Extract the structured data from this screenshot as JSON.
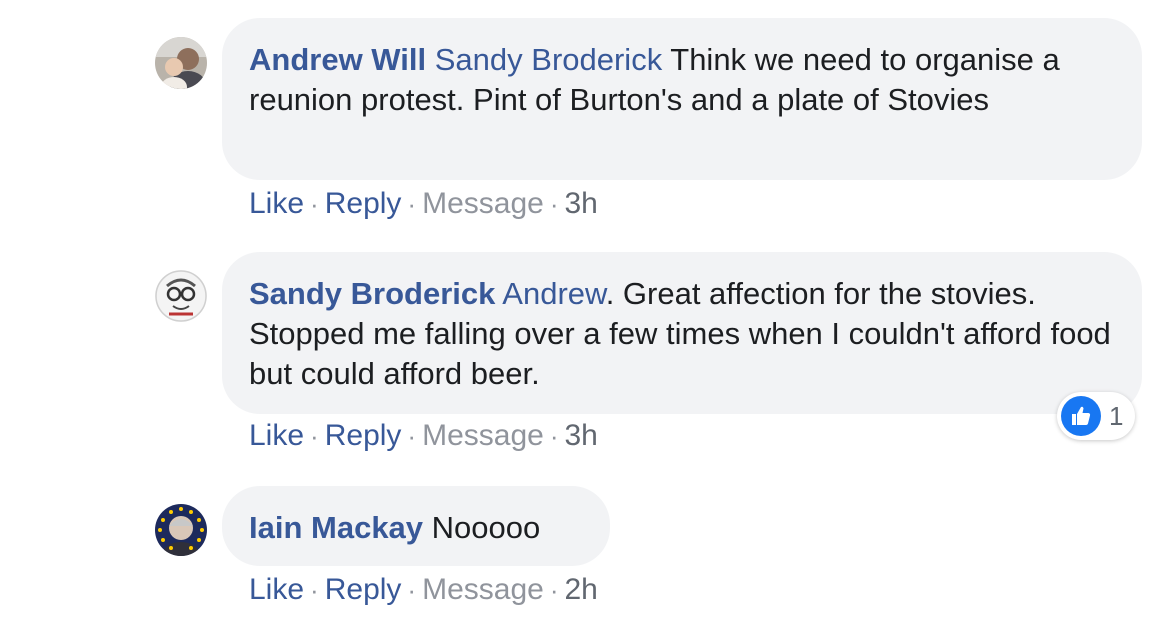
{
  "comments": [
    {
      "author": "Andrew Will",
      "mention": "Sandy Broderick",
      "text": " Think we need to organise a reunion protest. Pint of Burton's and a plate of Stovies",
      "actions": {
        "like": "Like",
        "reply": "Reply",
        "message": "Message",
        "time": "3h",
        "sep": "·"
      },
      "avatar_icon": "profile-photo-parent-child"
    },
    {
      "author": "Sandy Broderick",
      "mention": "Andrew",
      "text": ". Great affection for the stovies. Stopped me falling over a few times when I couldn't afford food but could afford beer.",
      "actions": {
        "like": "Like",
        "reply": "Reply",
        "message": "Message",
        "time": "3h",
        "sep": "·"
      },
      "avatar_icon": "profile-caricature",
      "reaction": {
        "icon": "thumbs-up-icon",
        "count": "1"
      }
    },
    {
      "author": "Iain Mackay",
      "mention": "",
      "text": " Nooooo",
      "actions": {
        "like": "Like",
        "reply": "Reply",
        "message": "Message",
        "time": "2h",
        "sep": "·"
      },
      "avatar_icon": "profile-photo-eu-stars-frame"
    }
  ],
  "colors": {
    "name_blue": "#385898",
    "bubble_bg": "#f2f3f5",
    "meta_grey": "#90949c",
    "like_blue": "#1877f2"
  }
}
